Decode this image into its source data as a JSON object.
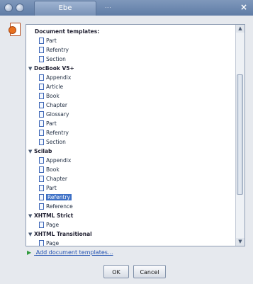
{
  "window": {
    "tab_title": "Ebe",
    "menu_text": "...",
    "close_glyph": "×"
  },
  "header": {
    "label": "Document templates:"
  },
  "tree": [
    {
      "level": 1,
      "label": "Part"
    },
    {
      "level": 1,
      "label": "Refentry"
    },
    {
      "level": 1,
      "label": "Section"
    },
    {
      "level": 0,
      "label": "DocBook V5+",
      "expanded": true
    },
    {
      "level": 1,
      "label": "Appendix"
    },
    {
      "level": 1,
      "label": "Article"
    },
    {
      "level": 1,
      "label": "Book"
    },
    {
      "level": 1,
      "label": "Chapter"
    },
    {
      "level": 1,
      "label": "Glossary"
    },
    {
      "level": 1,
      "label": "Part"
    },
    {
      "level": 1,
      "label": "Refentry"
    },
    {
      "level": 1,
      "label": "Section"
    },
    {
      "level": 0,
      "label": "Scilab",
      "expanded": true
    },
    {
      "level": 1,
      "label": "Appendix"
    },
    {
      "level": 1,
      "label": "Book"
    },
    {
      "level": 1,
      "label": "Chapter"
    },
    {
      "level": 1,
      "label": "Part"
    },
    {
      "level": 1,
      "label": "Refentry",
      "selected": true
    },
    {
      "level": 1,
      "label": "Reference"
    },
    {
      "level": 0,
      "label": "XHTML Strict",
      "expanded": true
    },
    {
      "level": 1,
      "label": "Page"
    },
    {
      "level": 0,
      "label": "XHTML Transitional",
      "expanded": true
    },
    {
      "level": 1,
      "label": "Page"
    }
  ],
  "footer": {
    "add_link": "Add document templates...",
    "ok": "OK",
    "cancel": "Cancel"
  }
}
